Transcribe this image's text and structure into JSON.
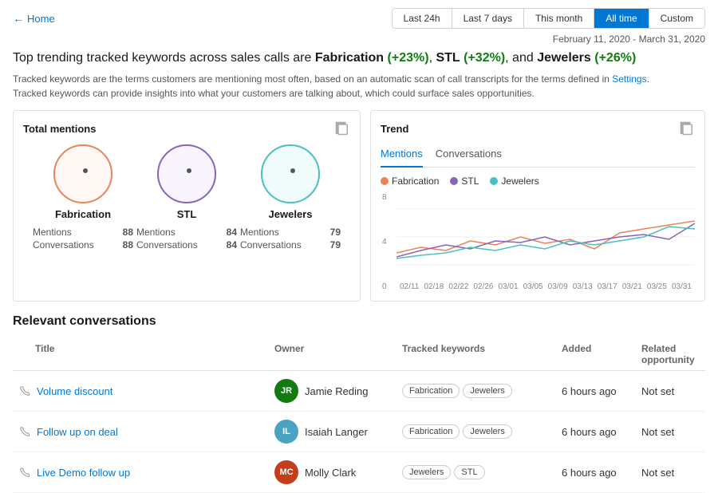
{
  "nav": {
    "back_label": "Home"
  },
  "time_filters": [
    {
      "label": "Last 24h",
      "active": false
    },
    {
      "label": "Last 7 days",
      "active": false
    },
    {
      "label": "This month",
      "active": false
    },
    {
      "label": "All time",
      "active": true
    },
    {
      "label": "Custom",
      "active": false
    }
  ],
  "date_range": "February 11, 2020 - March 31, 2020",
  "headline": {
    "prefix": "Top trending tracked keywords across sales calls are ",
    "kw1": "Fabrication",
    "kw1_pct": "(+23%)",
    "sep1": ", ",
    "kw2": "STL",
    "kw2_pct": "(+32%)",
    "sep2": ", and ",
    "kw3": "Jewelers",
    "kw3_pct": "(+26%)"
  },
  "description": {
    "line1": "Tracked keywords are the terms customers are mentioning most often, based on an automatic scan of call transcripts for the terms defined in ",
    "settings_link": "Settings",
    "period": ".",
    "line2": "Tracked keywords can provide insights into what your customers are talking about, which could surface sales opportunities."
  },
  "total_mentions": {
    "panel_title": "Total mentions",
    "items": [
      {
        "name": "Fabrication",
        "color_class": "circle-orange",
        "mentions": 88,
        "conversations": 88
      },
      {
        "name": "STL",
        "color_class": "circle-purple",
        "mentions": 84,
        "conversations": 84
      },
      {
        "name": "Jewelers",
        "color_class": "circle-teal",
        "mentions": 79,
        "conversations": 79
      }
    ],
    "mentions_label": "Mentions",
    "conversations_label": "Conversations"
  },
  "trend": {
    "panel_title": "Trend",
    "tabs": [
      "Mentions",
      "Conversations"
    ],
    "active_tab": "Mentions",
    "legend": [
      {
        "label": "Fabrication",
        "color": "#e8835a"
      },
      {
        "label": "STL",
        "color": "#8764b8"
      },
      {
        "label": "Jewelers",
        "color": "#4bbfc3"
      }
    ],
    "y_labels": [
      "0",
      "4",
      "8"
    ],
    "x_labels": [
      "02/11",
      "02/18",
      "02/22",
      "02/26",
      "03/01",
      "03/05",
      "03/09",
      "03/13",
      "03/17",
      "03/21",
      "03/25",
      "03/31"
    ]
  },
  "conversations": {
    "section_title": "Relevant conversations",
    "columns": [
      "Title",
      "Owner",
      "Tracked keywords",
      "Added",
      "Related opportunity"
    ],
    "rows": [
      {
        "phone": true,
        "title": "Volume discount",
        "owner_initials": "JR",
        "owner_name": "Jamie Reding",
        "owner_color": "#107c10",
        "tags": [
          "Fabrication",
          "Jewelers"
        ],
        "added": "6 hours ago",
        "related": "Not set"
      },
      {
        "phone": true,
        "title": "Follow up on deal",
        "owner_initials": "IL",
        "owner_name": "Isaiah Langer",
        "owner_color": "#4ba3c3",
        "tags": [
          "Fabrication",
          "Jewelers"
        ],
        "added": "6 hours ago",
        "related": "Not set"
      },
      {
        "phone": true,
        "title": "Live Demo follow up",
        "owner_initials": "MC",
        "owner_name": "Molly Clark",
        "owner_color": "#c43e1c",
        "tags": [
          "Jewelers",
          "STL"
        ],
        "added": "6 hours ago",
        "related": "Not set"
      }
    ]
  }
}
